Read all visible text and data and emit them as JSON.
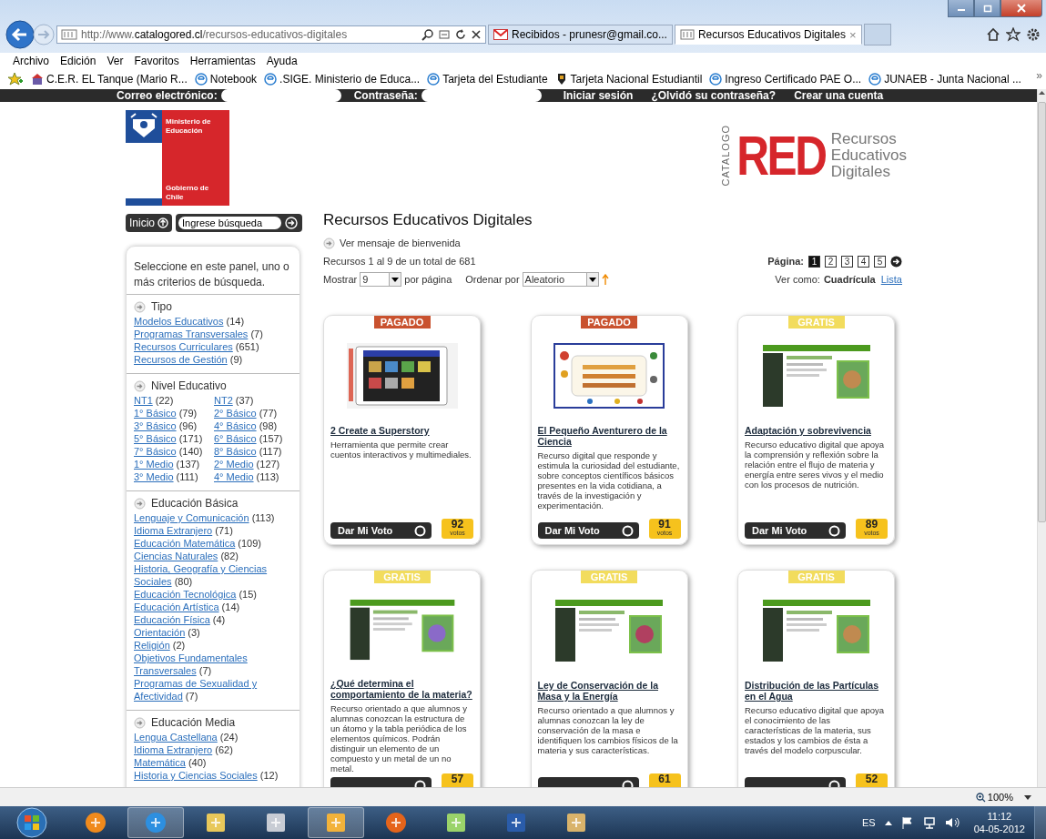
{
  "browser": {
    "address": {
      "scheme": "http://www.",
      "host": "catalogored.cl",
      "path": "/recursos-educativos-digitales"
    },
    "tabs": [
      {
        "title": "Recibidos - prunesr@gmail.co...",
        "selected": false
      },
      {
        "title": "Recursos Educativos Digitales",
        "selected": true,
        "close": "×"
      }
    ],
    "menu": [
      "Archivo",
      "Edición",
      "Ver",
      "Favoritos",
      "Herramientas",
      "Ayuda"
    ],
    "favorites": [
      "C.E.R. EL Tanque (Mario R...",
      "Notebook",
      ".SIGE. Ministerio de Educa...",
      "Tarjeta del Estudiante",
      "Tarjeta Nacional Estudiantil",
      "Ingreso Certificado PAE O...",
      "JUNAEB - Junta Nacional ..."
    ],
    "more": "»"
  },
  "login_bar": {
    "email_label": "Correo electrónico:",
    "password_label": "Contraseña:",
    "links": [
      "Iniciar sesión",
      "¿Olvidó su contraseña?",
      "Crear una cuenta"
    ]
  },
  "header": {
    "ministry": "Ministerio de Educación",
    "government": "Gobierno de Chile",
    "catalog_vertical": "CATALOGO",
    "catalog_big": "RED",
    "catalog_lines": [
      "Recursos",
      "Educativos",
      "Digitales"
    ]
  },
  "sidebar": {
    "home_button": "Inicio",
    "search": {
      "placeholder": "Ingrese búsqueda"
    },
    "intro": "Seleccione en este panel, uno o más criterios de búsqueda.",
    "sections": [
      {
        "title": "Tipo",
        "kind": "list",
        "items": [
          {
            "label": "Modelos Educativos",
            "count": "(14)"
          },
          {
            "label": "Programas Transversales",
            "count": "(7)"
          },
          {
            "label": "Recursos Curriculares",
            "count": "(651)"
          },
          {
            "label": "Recursos de Gestión",
            "count": "(9)"
          }
        ]
      },
      {
        "title": "Nivel Educativo",
        "kind": "grid",
        "items": [
          {
            "label": "NT1",
            "count": "(22)"
          },
          {
            "label": "NT2",
            "count": "(37)"
          },
          {
            "label": "1° Básico",
            "count": "(79)"
          },
          {
            "label": "2° Básico",
            "count": "(77)"
          },
          {
            "label": "3° Básico",
            "count": "(96)"
          },
          {
            "label": "4° Básico",
            "count": "(98)"
          },
          {
            "label": "5° Básico",
            "count": "(171)"
          },
          {
            "label": "6° Básico",
            "count": "(157)"
          },
          {
            "label": "7° Básico",
            "count": "(140)"
          },
          {
            "label": "8° Básico",
            "count": "(117)"
          },
          {
            "label": "1° Medio",
            "count": "(137)"
          },
          {
            "label": "2° Medio",
            "count": "(127)"
          },
          {
            "label": "3° Medio",
            "count": "(111)"
          },
          {
            "label": "4° Medio",
            "count": "(113)"
          }
        ]
      },
      {
        "title": "Educación Básica",
        "kind": "list",
        "items": [
          {
            "label": "Lenguaje y Comunicación",
            "count": "(113)"
          },
          {
            "label": "Idioma Extranjero",
            "count": "(71)"
          },
          {
            "label": "Educación Matemática",
            "count": "(109)"
          },
          {
            "label": "Ciencias Naturales",
            "count": "(82)"
          },
          {
            "label": "Historia, Geografía y Ciencias Sociales",
            "count": "(80)"
          },
          {
            "label": "Educación Tecnológica",
            "count": "(15)"
          },
          {
            "label": "Educación Artística",
            "count": "(14)"
          },
          {
            "label": "Educación Física",
            "count": "(4)"
          },
          {
            "label": "Orientación",
            "count": "(3)"
          },
          {
            "label": "Religión",
            "count": "(2)"
          },
          {
            "label": "Objetivos Fundamentales Transversales",
            "count": "(7)"
          },
          {
            "label": "Programas de Sexualidad y Afectividad",
            "count": "(7)"
          }
        ]
      },
      {
        "title": "Educación Media",
        "kind": "list",
        "items": [
          {
            "label": "Lengua Castellana",
            "count": "(24)"
          },
          {
            "label": "Idioma Extranjero",
            "count": "(62)"
          },
          {
            "label": "Matemática",
            "count": "(40)"
          },
          {
            "label": "Historia y Ciencias Sociales",
            "count": "(12)"
          }
        ]
      }
    ]
  },
  "main": {
    "title": "Recursos Educativos Digitales",
    "welcome_link": "Ver mensaje de bienvenida",
    "results": "Recursos 1 al 9 de un total de 681",
    "page_label": "Página:",
    "pages": [
      {
        "label": "1",
        "selected": true
      },
      {
        "label": "2",
        "selected": false
      },
      {
        "label": "3",
        "selected": false
      },
      {
        "label": "4",
        "selected": false
      },
      {
        "label": "5",
        "selected": false
      }
    ],
    "show_label": "Mostrar",
    "show_value": "9",
    "per_page": "por página",
    "order_label": "Ordenar por",
    "order_value": "Aleatorio",
    "view_label": "Ver como:",
    "view_current": "Cuadrícula",
    "view_other": "Lista",
    "cards": [
      {
        "badge": "PAGADO",
        "color": "#c9522f",
        "title": "2 Create a Superstory",
        "description": "Herramienta que permite crear cuentos interactivos y multimediales.",
        "vote_button": "Dar Mi Voto",
        "votes": "92",
        "votes_label": "votos"
      },
      {
        "badge": "PAGADO",
        "color": "#c9522f",
        "title": "El Pequeño Aventurero de la Ciencia",
        "description": "Recurso digital que responde y estimula la curiosidad del estudiante, sobre conceptos científicos básicos presentes en la vida cotidiana, a través de la investigación y experimentación.",
        "vote_button": "Dar Mi Voto",
        "votes": "91",
        "votes_label": "votos"
      },
      {
        "badge": "GRATIS",
        "color": "#f2dc5d",
        "title": "Adaptación y sobrevivencia",
        "description": "Recurso educativo digital que apoya la comprensión y reflexión sobre la relación entre el flujo de materia y energía entre seres vivos y el medio con los procesos de nutrición.",
        "vote_button": "Dar Mi Voto",
        "votes": "89",
        "votes_label": "votos"
      },
      {
        "badge": "GRATIS",
        "color": "#f2dc5d",
        "title": "¿Qué determina el comportamiento de la materia?",
        "description": "Recurso orientado a que alumnos y alumnas conozcan la estructura de un átomo y la tabla periódica de los elementos químicos. Podrán distinguir un elemento de un compuesto y un metal de un no metal.",
        "votes": "57"
      },
      {
        "badge": "GRATIS",
        "color": "#f2dc5d",
        "title": "Ley de Conservación de la Masa y la Energía",
        "description": "Recurso orientado a que alumnos y alumnas conozcan la ley de conservación de la masa e identifiquen los cambios físicos de la materia y sus características.",
        "votes": "61"
      },
      {
        "badge": "GRATIS",
        "color": "#f2dc5d",
        "title": "Distribución de las Partículas en el Agua",
        "description": "Recurso educativo digital que apoya el conocimiento de las características de la materia, sus estados y los cambios de ésta a través del modelo corpuscular.",
        "votes": "52"
      }
    ]
  },
  "status_bar": {
    "zoom": "100%"
  },
  "taskbar": {
    "apps": [
      {
        "active": false
      },
      {
        "active": true
      },
      {
        "active": false
      },
      {
        "active": false
      },
      {
        "active": true
      },
      {
        "active": false
      },
      {
        "active": false
      },
      {
        "active": false
      },
      {
        "active": false
      }
    ],
    "language": "ES",
    "time": "11:12",
    "date": "04-05-2012"
  }
}
